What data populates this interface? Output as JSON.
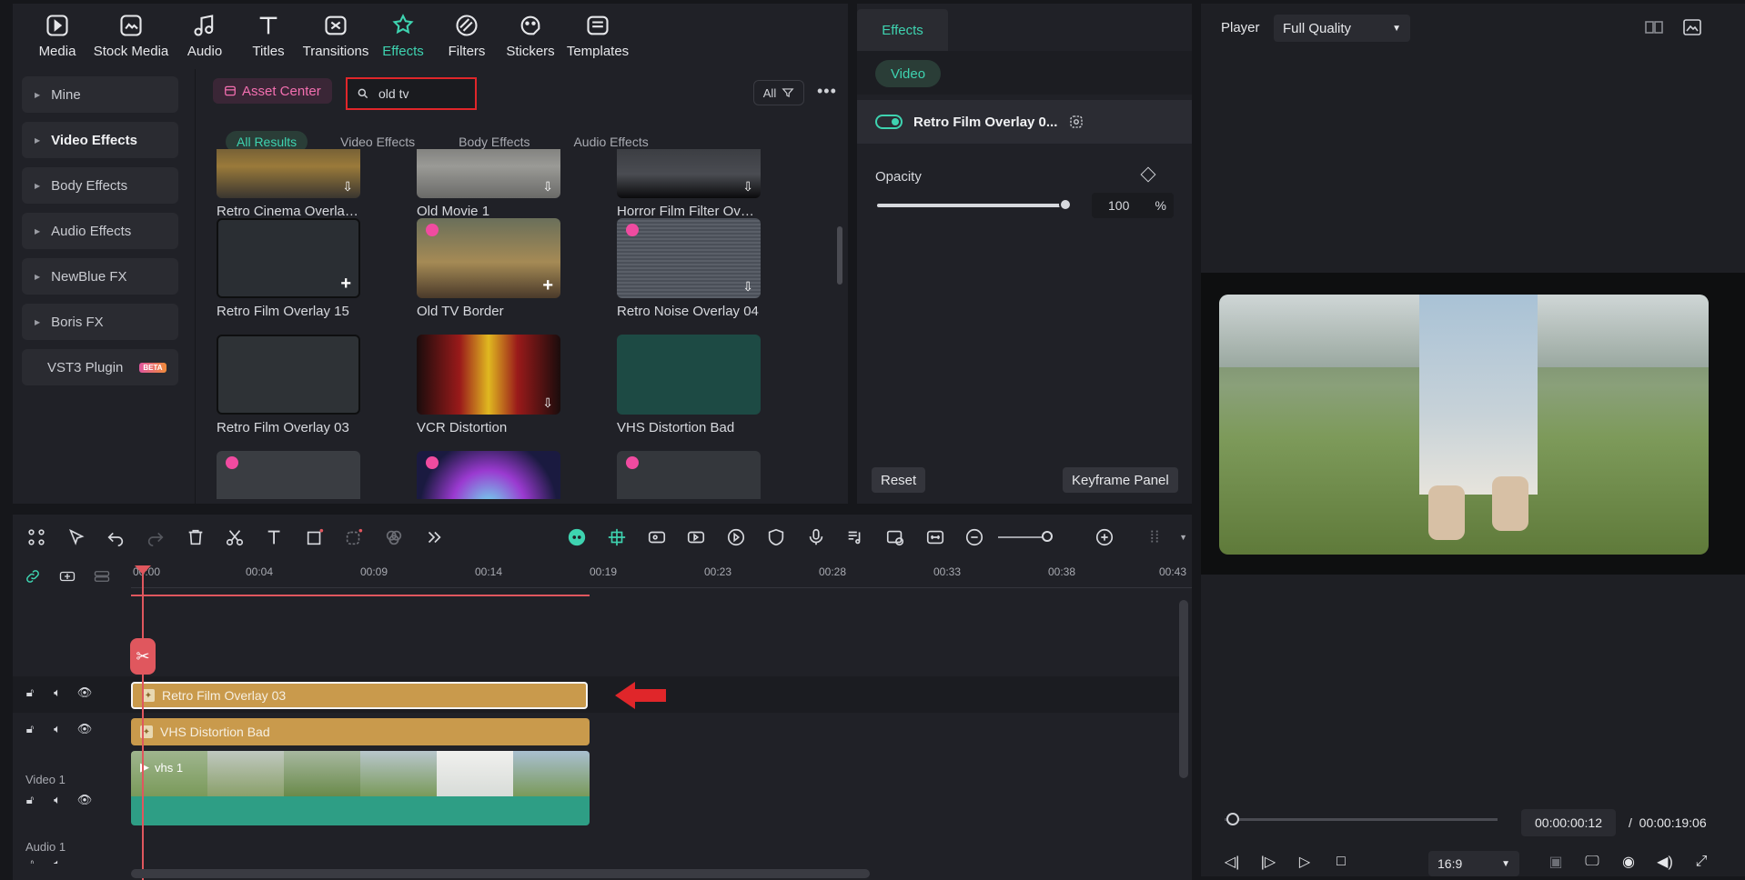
{
  "top_tabs": [
    {
      "label": "Media",
      "icon": "media-icon"
    },
    {
      "label": "Stock Media",
      "icon": "stock-media-icon"
    },
    {
      "label": "Audio",
      "icon": "audio-icon"
    },
    {
      "label": "Titles",
      "icon": "titles-icon"
    },
    {
      "label": "Transitions",
      "icon": "transitions-icon"
    },
    {
      "label": "Effects",
      "icon": "effects-icon"
    },
    {
      "label": "Filters",
      "icon": "filters-icon"
    },
    {
      "label": "Stickers",
      "icon": "stickers-icon"
    },
    {
      "label": "Templates",
      "icon": "templates-icon"
    }
  ],
  "sidebar": {
    "items": [
      {
        "label": "Mine"
      },
      {
        "label": "Video Effects"
      },
      {
        "label": "Body Effects"
      },
      {
        "label": "Audio Effects"
      },
      {
        "label": "NewBlue FX"
      },
      {
        "label": "Boris FX"
      },
      {
        "label": "VST3 Plugin",
        "badge": "BETA"
      }
    ]
  },
  "library": {
    "asset_center": "Asset Center",
    "search_value": "old tv",
    "filter_label": "All",
    "more": "•••",
    "subtabs": [
      "All Results",
      "Video Effects",
      "Body Effects",
      "Audio Effects"
    ],
    "results": [
      {
        "label": "Retro Cinema Overlay ...",
        "action": "download"
      },
      {
        "label": "Old Movie 1",
        "action": "download"
      },
      {
        "label": "Horror Film Filter Over...",
        "action": "download"
      },
      {
        "label": "Retro Film Overlay 15",
        "action": "add"
      },
      {
        "label": "Old TV Border",
        "action": "add"
      },
      {
        "label": "Retro Noise Overlay 04",
        "action": "download"
      },
      {
        "label": "Retro Film Overlay 03",
        "action": "none"
      },
      {
        "label": "VCR Distortion",
        "action": "download"
      },
      {
        "label": "VHS Distortion Bad",
        "action": "none"
      }
    ]
  },
  "effects_panel": {
    "tab": "Effects",
    "video_pill": "Video",
    "effect_name": "Retro Film Overlay 0...",
    "opacity_label": "Opacity",
    "opacity_value": "100",
    "opacity_unit": "%",
    "opacity_fraction": 1.0,
    "reset": "Reset",
    "keyframe": "Keyframe Panel"
  },
  "player": {
    "title": "Player",
    "quality": "Full Quality",
    "current_time": "00:00:00:12",
    "separator": "/",
    "total_time": "00:00:19:06",
    "ratio": "16:9"
  },
  "timeline": {
    "ticks": [
      "00:00",
      "00:04",
      "00:09",
      "00:14",
      "00:19",
      "00:23",
      "00:28",
      "00:33",
      "00:38",
      "00:43"
    ],
    "tracks": {
      "overlay_clip": "Retro Film Overlay 03",
      "vhs_clip": "VHS Distortion Bad",
      "video_label": "Video 1",
      "video_clip": "vhs 1",
      "audio_label": "Audio 1"
    }
  },
  "colors": {
    "accent": "#3ed3b0",
    "playhead": "#e0575e",
    "clip": "#c99a4c",
    "highlight_box": "#e0262a"
  }
}
